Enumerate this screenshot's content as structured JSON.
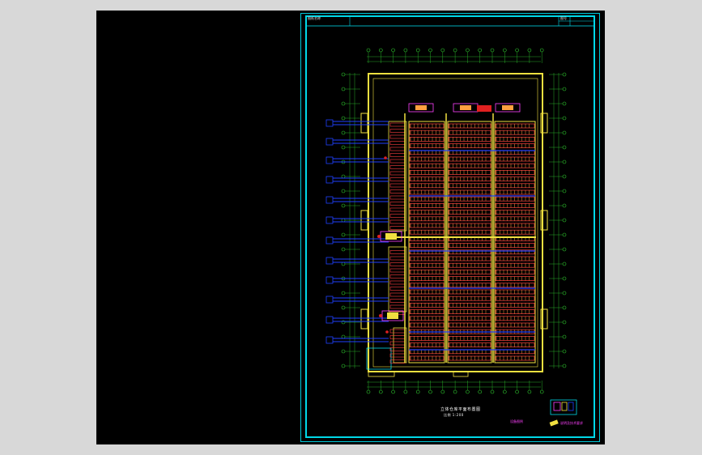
{
  "viewport": {
    "background": "#000000"
  },
  "colors": {
    "frame": "#00d8e8",
    "grid_axis": "#30d030",
    "wall": "#f0e040",
    "rack": "#ff4040",
    "cell": "#ffa040",
    "conveyor": "#2040ff",
    "tag": "#ff40ff"
  },
  "drawing": {
    "title_block_top_left": "图纸名称",
    "title_block_top_right": "图号",
    "main_title": "立体仓库平面布置图",
    "subtitle": "比例 1:200",
    "legend_label": "设备图例",
    "note_label": "说明及技术要求"
  }
}
